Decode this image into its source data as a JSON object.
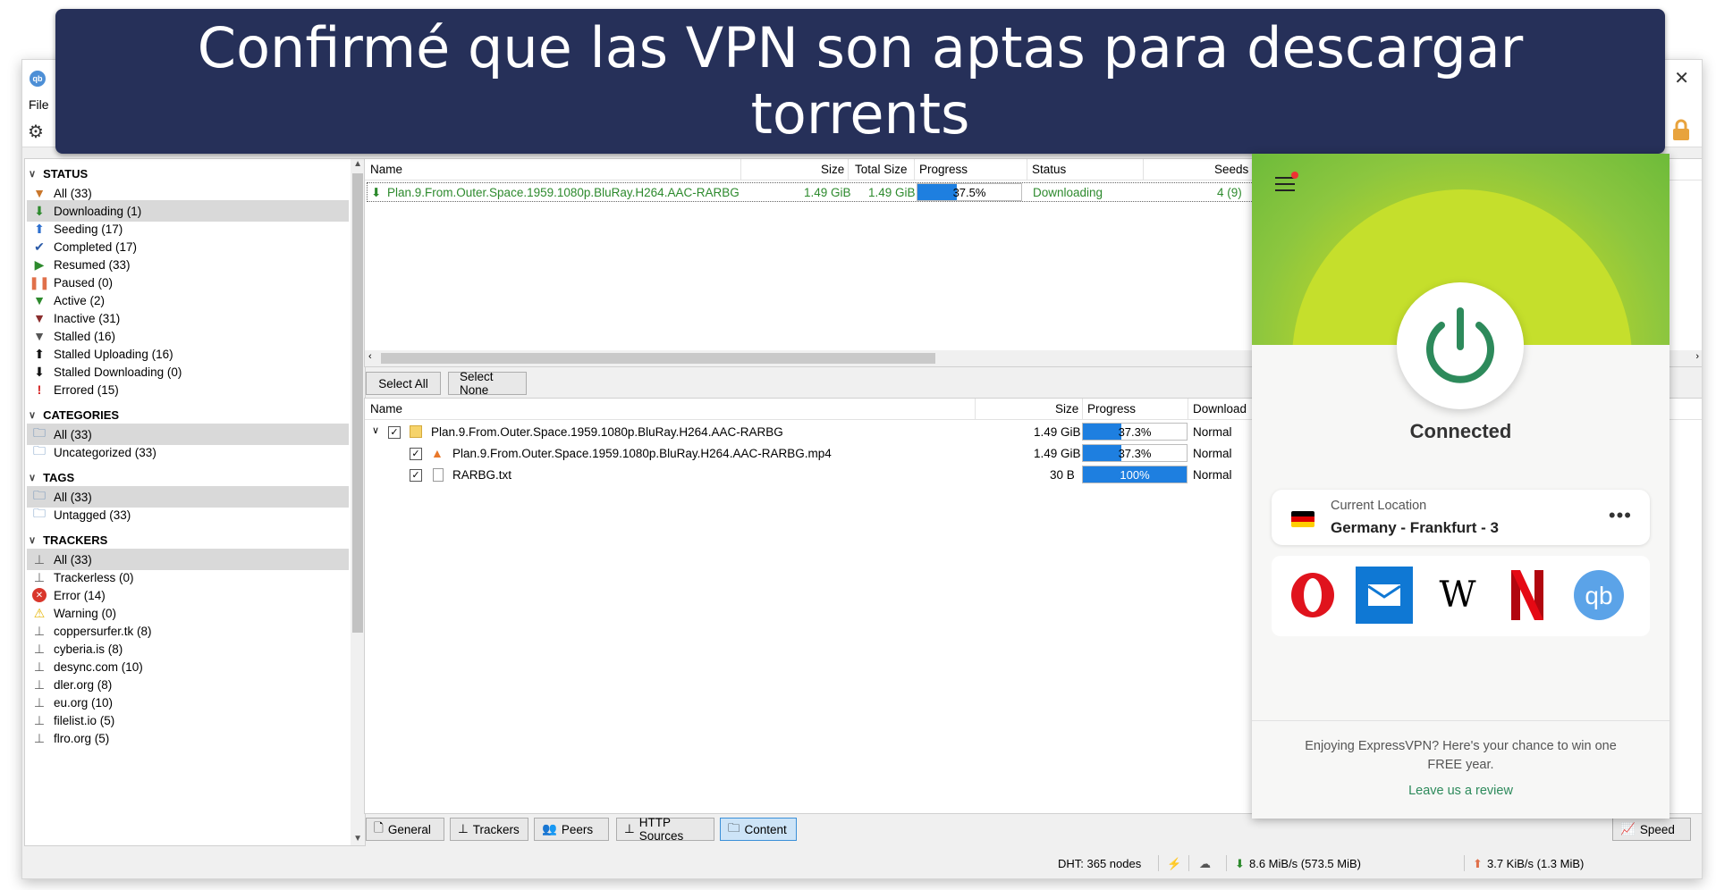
{
  "banner": {
    "title": "Confirmé que las VPN son aptas para descargar torrents"
  },
  "window": {
    "menu_file": "File"
  },
  "sidebar": {
    "status_header": "STATUS",
    "status_items": [
      {
        "label": "All (33)",
        "icon": "filter-icon"
      },
      {
        "label": "Downloading (1)",
        "icon": "download-arrow-icon"
      },
      {
        "label": "Seeding (17)",
        "icon": "upload-arrow-icon"
      },
      {
        "label": "Completed (17)",
        "icon": "checkmark-icon"
      },
      {
        "label": "Resumed (33)",
        "icon": "play-icon"
      },
      {
        "label": "Paused (0)",
        "icon": "pause-icon"
      },
      {
        "label": "Active (2)",
        "icon": "filter-icon"
      },
      {
        "label": "Inactive (31)",
        "icon": "filter-icon"
      },
      {
        "label": "Stalled (16)",
        "icon": "filter-icon"
      },
      {
        "label": "Stalled Uploading (16)",
        "icon": "upload-arrow-icon"
      },
      {
        "label": "Stalled Downloading (0)",
        "icon": "download-arrow-icon"
      },
      {
        "label": "Errored (15)",
        "icon": "exclamation-icon"
      }
    ],
    "categories_header": "CATEGORIES",
    "categories_items": [
      "All (33)",
      "Uncategorized (33)"
    ],
    "tags_header": "TAGS",
    "tags_items": [
      "All (33)",
      "Untagged (33)"
    ],
    "trackers_header": "TRACKERS",
    "trackers_items": [
      {
        "label": "All (33)",
        "icon": "tracker-icon"
      },
      {
        "label": "Trackerless (0)",
        "icon": "tracker-icon"
      },
      {
        "label": "Error (14)",
        "icon": "error-icon"
      },
      {
        "label": "Warning (0)",
        "icon": "warning-icon"
      },
      {
        "label": "coppersurfer.tk (8)",
        "icon": "tracker-icon"
      },
      {
        "label": "cyberia.is (8)",
        "icon": "tracker-icon"
      },
      {
        "label": "desync.com (10)",
        "icon": "tracker-icon"
      },
      {
        "label": "dler.org (8)",
        "icon": "tracker-icon"
      },
      {
        "label": "eu.org (10)",
        "icon": "tracker-icon"
      },
      {
        "label": "filelist.io (5)",
        "icon": "tracker-icon"
      },
      {
        "label": "flro.org (5)",
        "icon": "tracker-icon"
      }
    ]
  },
  "transfer": {
    "headers": {
      "name": "Name",
      "size": "Size",
      "total_size": "Total Size",
      "progress": "Progress",
      "status": "Status",
      "seeds": "Seeds"
    },
    "row": {
      "name": "Plan.9.From.Outer.Space.1959.1080p.BluRay.H264.AAC-RARBG",
      "size": "1.49 GiB",
      "total_size": "1.49 GiB",
      "progress_text": "37.5%",
      "progress": 0.375,
      "status": "Downloading",
      "seeds": "4 (9)"
    }
  },
  "select_buttons": {
    "all": "Select All",
    "none": "Select None"
  },
  "content": {
    "headers": {
      "name": "Name",
      "size": "Size",
      "progress": "Progress",
      "priority": "Download"
    },
    "rows": [
      {
        "name": "Plan.9.From.Outer.Space.1959.1080p.BluRay.H264.AAC-RARBG",
        "size": "1.49 GiB",
        "progress_text": "37.3%",
        "progress": 0.373,
        "priority": "Normal"
      },
      {
        "name": "Plan.9.From.Outer.Space.1959.1080p.BluRay.H264.AAC-RARBG.mp4",
        "size": "1.49 GiB",
        "progress_text": "37.3%",
        "progress": 0.373,
        "priority": "Normal"
      },
      {
        "name": "RARBG.txt",
        "size": "30 B",
        "progress_text": "100%",
        "progress": 1.0,
        "priority": "Normal"
      }
    ]
  },
  "tabs": [
    "General",
    "Trackers",
    "Peers",
    "HTTP Sources",
    "Content"
  ],
  "speed_button": "Speed",
  "statusbar": {
    "dht": "DHT: 365 nodes",
    "download": "8.6 MiB/s (573.5 MiB)",
    "upload": "3.7 KiB/s (1.3 MiB)"
  },
  "vpn": {
    "status": "Connected",
    "location_label": "Current Location",
    "location_name": "Germany - Frankfurt - 3",
    "shortcuts": [
      "opera-icon",
      "mail-icon",
      "wikipedia-icon",
      "netflix-icon",
      "qbittorrent-icon"
    ],
    "promo_text": "Enjoying ExpressVPN? Here's your chance to win one FREE year.",
    "promo_link": "Leave us a review"
  },
  "colors": {
    "banner_bg": "#263059",
    "progress_fill": "#1e7fe0",
    "vpn_green": "#2d8a5b",
    "downloading_green": "#2d8a2d"
  }
}
